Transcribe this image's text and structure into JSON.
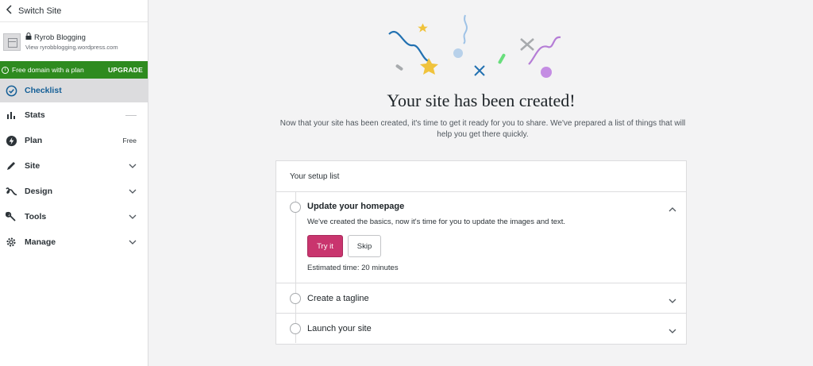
{
  "sidebar": {
    "switch_site": "Switch Site",
    "site_name": "Ryrob Blogging",
    "site_url": "View ryrobblogging.wordpress.com",
    "banner_text": "Free domain with a plan",
    "banner_action": "UPGRADE",
    "items": [
      {
        "label": "Checklist",
        "icon": "checklist-icon",
        "active": true
      },
      {
        "label": "Stats",
        "icon": "stats-icon"
      },
      {
        "label": "Plan",
        "icon": "plan-icon",
        "extra": "Free"
      },
      {
        "label": "Site",
        "icon": "pencil-icon"
      },
      {
        "label": "Design",
        "icon": "design-icon"
      },
      {
        "label": "Tools",
        "icon": "wrench-icon"
      },
      {
        "label": "Manage",
        "icon": "gear-icon"
      }
    ]
  },
  "main": {
    "title": "Your site has been created!",
    "subtitle": "Now that your site has been created, it's time to get it ready for you to share. We've prepared a list of things that will help you get there quickly.",
    "setup_list": {
      "header": "Your setup list",
      "tasks": [
        {
          "title": "Update your homepage",
          "description": "We've created the basics, now it's time for you to update the images and text.",
          "primary_button": "Try it",
          "secondary_button": "Skip",
          "estimate": "Estimated time: 20 minutes"
        },
        {
          "title": "Create a tagline"
        },
        {
          "title": "Launch your site"
        }
      ]
    }
  },
  "colors": {
    "accent_green": "#2e8b1f",
    "primary_pink": "#c9356e",
    "active_blue": "#135e96"
  }
}
